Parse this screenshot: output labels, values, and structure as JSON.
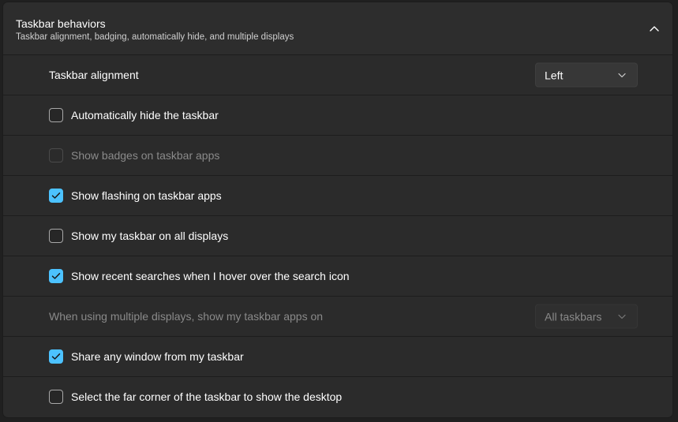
{
  "header": {
    "title": "Taskbar behaviors",
    "subtitle": "Taskbar alignment, badging, automatically hide, and multiple displays",
    "collapse_icon": "chevron-up-icon"
  },
  "colors": {
    "accent": "#4cc2ff",
    "background": "#202020",
    "row_background": "#2b2b2b",
    "disabled_text": "#8a8a8a"
  },
  "alignment": {
    "label": "Taskbar alignment",
    "value": "Left"
  },
  "options": {
    "auto_hide": {
      "label": "Automatically hide the taskbar",
      "checked": false,
      "disabled": false
    },
    "badges": {
      "label": "Show badges on taskbar apps",
      "checked": false,
      "disabled": true
    },
    "flashing": {
      "label": "Show flashing on taskbar apps",
      "checked": true,
      "disabled": false
    },
    "all_displays": {
      "label": "Show my taskbar on all displays",
      "checked": false,
      "disabled": false
    },
    "recent_searches": {
      "label": "Show recent searches when I hover over the search icon",
      "checked": true,
      "disabled": false
    },
    "share_window": {
      "label": "Share any window from my taskbar",
      "checked": true,
      "disabled": false
    },
    "far_corner": {
      "label": "Select the far corner of the taskbar to show the desktop",
      "checked": false,
      "disabled": false
    }
  },
  "multi_display": {
    "label": "When using multiple displays, show my taskbar apps on",
    "value": "All taskbars",
    "disabled": true
  }
}
